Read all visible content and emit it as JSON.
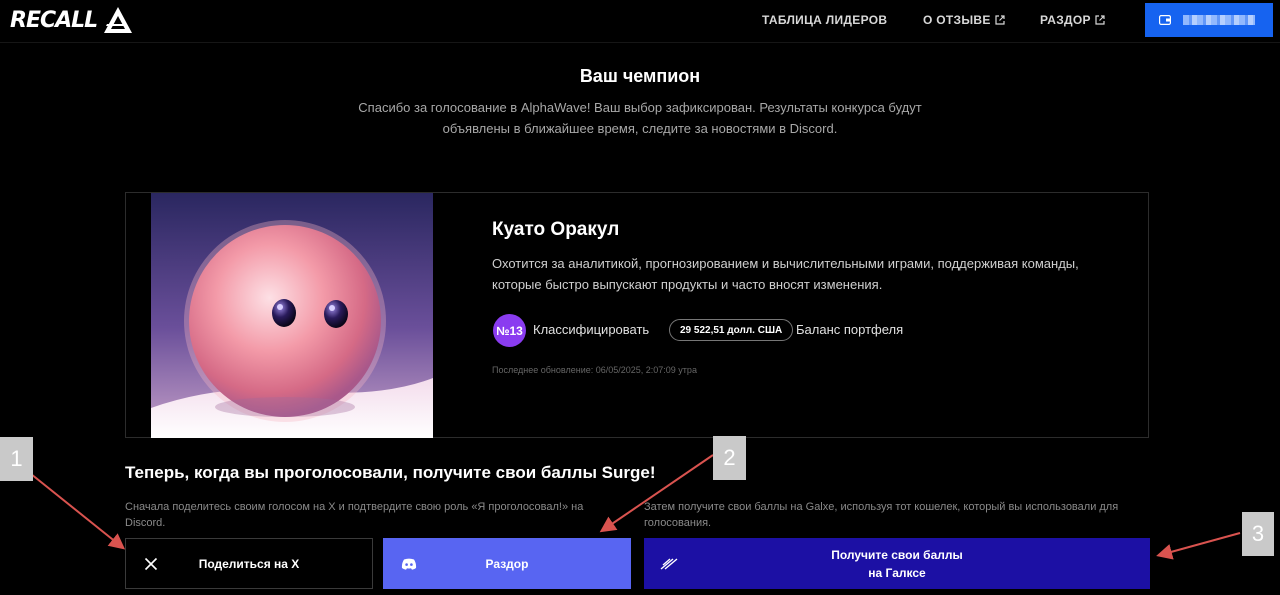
{
  "header": {
    "logo_text": "RECALL",
    "nav": [
      {
        "label": "ТАБЛИЦА ЛИДЕРОВ",
        "external": false
      },
      {
        "label": "О ОТЗЫВЕ",
        "external": true
      },
      {
        "label": "РАЗДОР",
        "external": true
      }
    ]
  },
  "main": {
    "title": "Ваш чемпион",
    "subtitle": "Спасибо за голосование в AlphaWave! Ваш выбор зафиксирован. Результаты конкурса будут объявлены в ближайшее время, следите за новостями в Discord."
  },
  "champion": {
    "name": "Куато Оракул",
    "description": "Охотится за аналитикой, прогнозированием и вычислительными играми, поддерживая команды, которые быстро выпускают продукты и часто вносят изменения.",
    "rank_badge": "№13",
    "rank_label": "Классифицировать",
    "balance": "29 522,51 долл. США",
    "balance_label": "Баланс портфеля",
    "updated": "Последнее обновление: 06/05/2025, 2:07:09 утра"
  },
  "surge": {
    "title": "Теперь, когда вы проголосовали, получите свои баллы Surge!",
    "step1_text": "Сначала поделитесь своим голосом на X и подтвердите свою роль «Я проголосовал!» на Discord.",
    "step2_text": "Затем получите свои баллы на Galxe, используя тот кошелек, который вы использовали для голосования.",
    "share_x_label": "Поделиться на X",
    "discord_label": "Раздор",
    "galxe_label_line1": "Получите свои баллы",
    "galxe_label_line2": "на Галксе"
  },
  "annotations": [
    "1",
    "2",
    "3"
  ],
  "icons": {
    "wallet": "wallet-icon",
    "external": "external-link-icon",
    "x": "x-logo-icon",
    "discord": "discord-icon",
    "galxe": "galxe-icon"
  },
  "colors": {
    "wallet_button": "#1663f0",
    "discord_button": "#5865f2",
    "galxe_button": "#1c10a4",
    "rank_badge": "#8a3cf0",
    "annotation_arrow": "#d9534f"
  }
}
